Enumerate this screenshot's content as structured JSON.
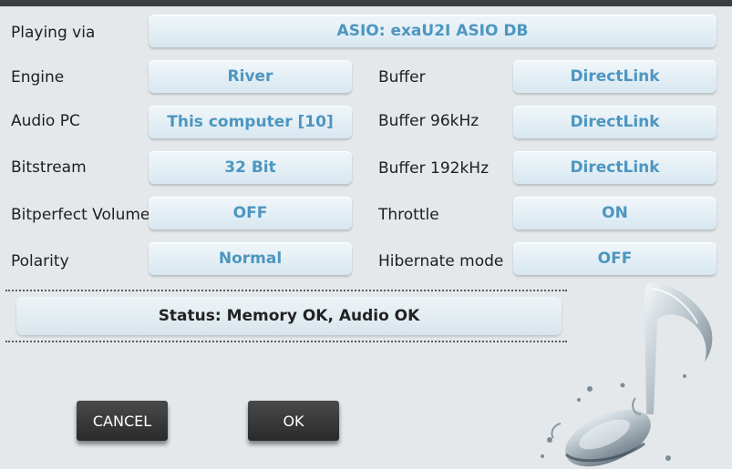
{
  "settings_left": [
    {
      "label": "Engine",
      "value": "River"
    },
    {
      "label": "Audio PC",
      "value": "This computer [10]"
    },
    {
      "label": "Bitstream",
      "value": "32 Bit"
    },
    {
      "label": "Bitperfect Volume",
      "value": "OFF"
    },
    {
      "label": "Polarity",
      "value": "Normal"
    }
  ],
  "settings_right": [
    {
      "label": "Buffer",
      "value": "DirectLink"
    },
    {
      "label": "Buffer 96kHz",
      "value": "DirectLink"
    },
    {
      "label": "Buffer 192kHz",
      "value": "DirectLink"
    },
    {
      "label": "Throttle",
      "value": "ON"
    },
    {
      "label": "Hibernate mode",
      "value": "OFF"
    }
  ],
  "playing_via": {
    "label": "Playing via",
    "value": "ASIO: exaU2I ASIO DB"
  },
  "status": "Status: Memory OK, Audio OK",
  "buttons": {
    "cancel": "CANCEL",
    "ok": "OK"
  },
  "colors": {
    "value_text": "#4d96c0",
    "background": "#e4e8eb",
    "action_button": "#333333"
  },
  "decoration": "water-splash-music-note-icon"
}
